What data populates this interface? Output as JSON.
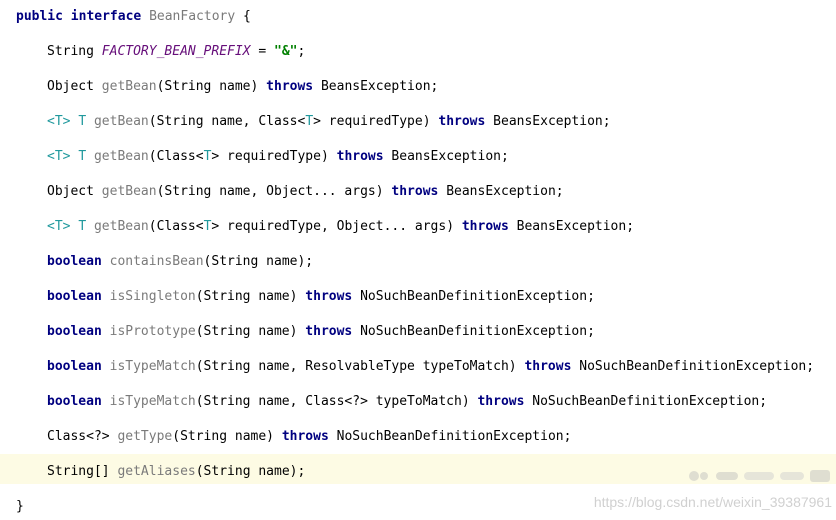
{
  "code": {
    "lines": [
      {
        "tokens": [
          [
            "kw",
            "public"
          ],
          [
            "pl",
            " "
          ],
          [
            "kw",
            "interface"
          ],
          [
            "pl",
            " "
          ],
          [
            "m",
            "BeanFactory"
          ],
          [
            "pl",
            " {"
          ]
        ]
      },
      {
        "tokens": [
          [
            "pl",
            "String "
          ],
          [
            "cn",
            "FACTORY_BEAN_PREFIX"
          ],
          [
            "pl",
            " = "
          ],
          [
            "st",
            "\"&\""
          ],
          [
            "pl",
            ";"
          ]
        ]
      },
      {
        "tokens": [
          [
            "pl",
            "Object "
          ],
          [
            "m",
            "getBean"
          ],
          [
            "pl",
            "(String name) "
          ],
          [
            "kw",
            "throws"
          ],
          [
            "pl",
            " BeansException;"
          ]
        ]
      },
      {
        "tokens": [
          [
            "tp",
            "<T>"
          ],
          [
            "pl",
            " "
          ],
          [
            "tp",
            "T"
          ],
          [
            "pl",
            " "
          ],
          [
            "m",
            "getBean"
          ],
          [
            "pl",
            "(String name, Class<"
          ],
          [
            "tp",
            "T"
          ],
          [
            "pl",
            "> requiredType) "
          ],
          [
            "kw",
            "throws"
          ],
          [
            "pl",
            " BeansException;"
          ]
        ]
      },
      {
        "tokens": [
          [
            "tp",
            "<T>"
          ],
          [
            "pl",
            " "
          ],
          [
            "tp",
            "T"
          ],
          [
            "pl",
            " "
          ],
          [
            "m",
            "getBean"
          ],
          [
            "pl",
            "(Class<"
          ],
          [
            "tp",
            "T"
          ],
          [
            "pl",
            "> requiredType) "
          ],
          [
            "kw",
            "throws"
          ],
          [
            "pl",
            " BeansException;"
          ]
        ]
      },
      {
        "tokens": [
          [
            "pl",
            "Object "
          ],
          [
            "m",
            "getBean"
          ],
          [
            "pl",
            "(String name, Object... args) "
          ],
          [
            "kw",
            "throws"
          ],
          [
            "pl",
            " BeansException;"
          ]
        ]
      },
      {
        "tokens": [
          [
            "tp",
            "<T>"
          ],
          [
            "pl",
            " "
          ],
          [
            "tp",
            "T"
          ],
          [
            "pl",
            " "
          ],
          [
            "m",
            "getBean"
          ],
          [
            "pl",
            "(Class<"
          ],
          [
            "tp",
            "T"
          ],
          [
            "pl",
            "> requiredType, Object... args) "
          ],
          [
            "kw",
            "throws"
          ],
          [
            "pl",
            " BeansException;"
          ]
        ]
      },
      {
        "tokens": [
          [
            "kw",
            "boolean"
          ],
          [
            "pl",
            " "
          ],
          [
            "m",
            "containsBean"
          ],
          [
            "pl",
            "(String name);"
          ]
        ]
      },
      {
        "tokens": [
          [
            "kw",
            "boolean"
          ],
          [
            "pl",
            " "
          ],
          [
            "m",
            "isSingleton"
          ],
          [
            "pl",
            "(String name) "
          ],
          [
            "kw",
            "throws"
          ],
          [
            "pl",
            " NoSuchBeanDefinitionException;"
          ]
        ]
      },
      {
        "tokens": [
          [
            "kw",
            "boolean"
          ],
          [
            "pl",
            " "
          ],
          [
            "m",
            "isPrototype"
          ],
          [
            "pl",
            "(String name) "
          ],
          [
            "kw",
            "throws"
          ],
          [
            "pl",
            " NoSuchBeanDefinitionException;"
          ]
        ]
      },
      {
        "tokens": [
          [
            "kw",
            "boolean"
          ],
          [
            "pl",
            " "
          ],
          [
            "m",
            "isTypeMatch"
          ],
          [
            "pl",
            "(String name, ResolvableType typeToMatch) "
          ],
          [
            "kw",
            "throws"
          ],
          [
            "pl",
            " NoSuchBeanDefinitionException;"
          ]
        ]
      },
      {
        "tokens": [
          [
            "kw",
            "boolean"
          ],
          [
            "pl",
            " "
          ],
          [
            "m",
            "isTypeMatch"
          ],
          [
            "pl",
            "(String name, Class<?> typeToMatch) "
          ],
          [
            "kw",
            "throws"
          ],
          [
            "pl",
            " NoSuchBeanDefinitionException;"
          ]
        ]
      },
      {
        "tokens": [
          [
            "pl",
            "Class<?> "
          ],
          [
            "m",
            "getType"
          ],
          [
            "pl",
            "(String name) "
          ],
          [
            "kw",
            "throws"
          ],
          [
            "pl",
            " NoSuchBeanDefinitionException;"
          ]
        ]
      },
      {
        "tokens": [
          [
            "pl",
            "String[] "
          ],
          [
            "m",
            "getAliases"
          ],
          [
            "pl",
            "(String name);"
          ]
        ]
      },
      {
        "tokens": [
          [
            "pl",
            "}"
          ]
        ]
      }
    ]
  },
  "watermark": {
    "text": "https://blog.csdn.net/weixin_39387961"
  }
}
